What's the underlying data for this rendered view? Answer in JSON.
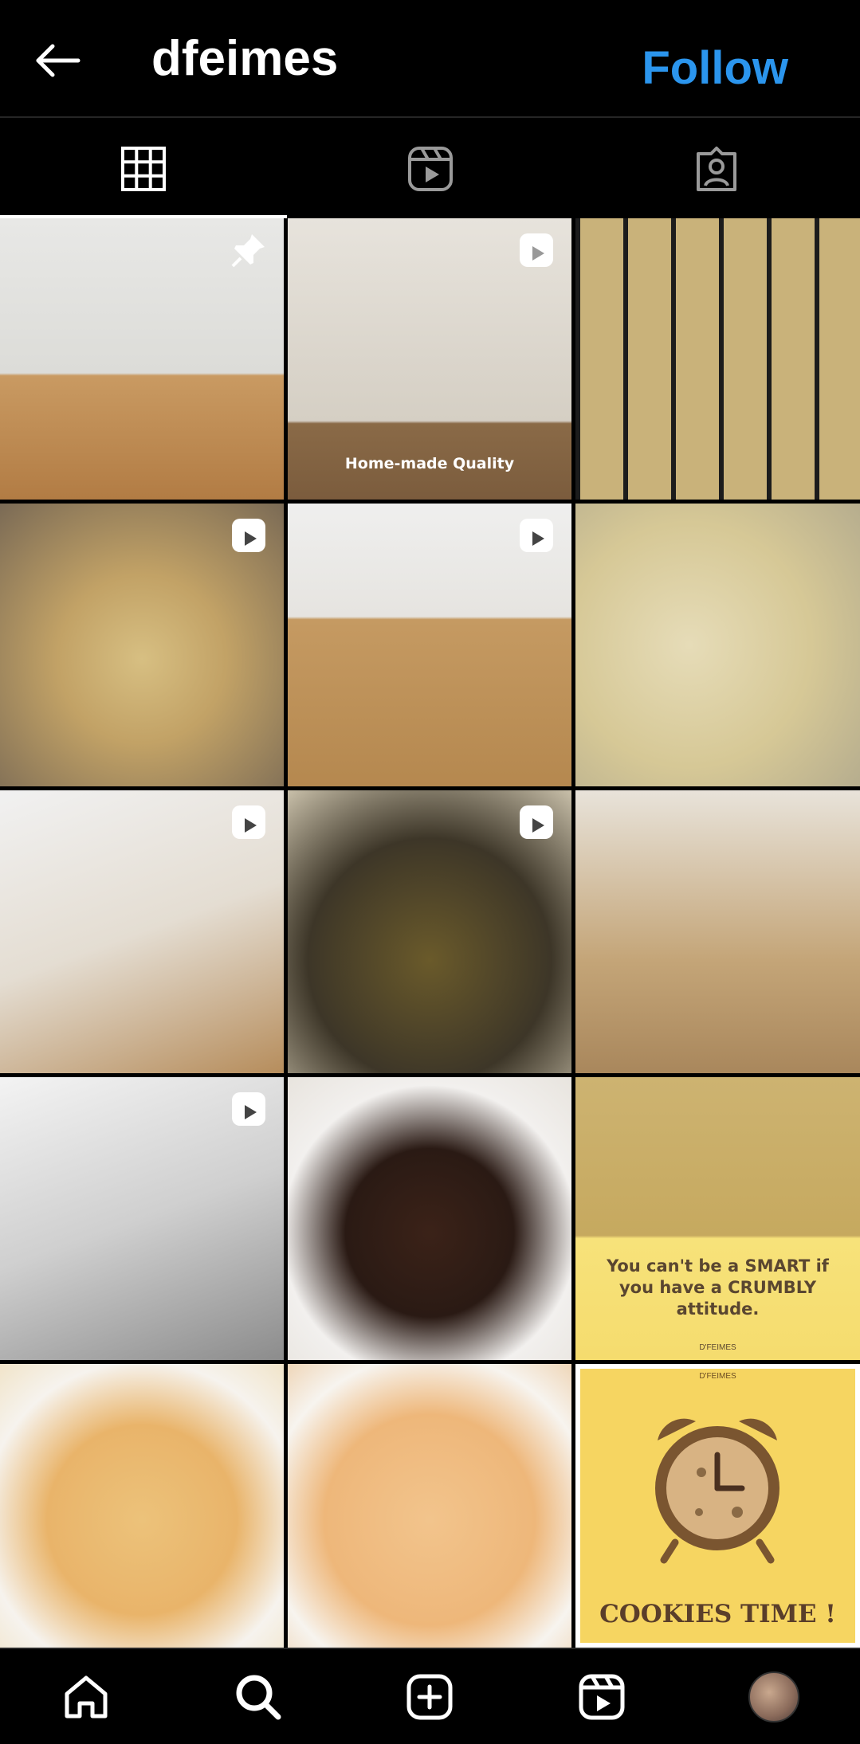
{
  "header": {
    "username": "dfeimes",
    "follow_label": "Follow",
    "back_icon": "arrow-left-icon"
  },
  "tabs": [
    {
      "name": "posts",
      "icon": "grid-icon",
      "active": true
    },
    {
      "name": "reels",
      "icon": "reels-icon",
      "active": false
    },
    {
      "name": "tagged",
      "icon": "tagged-user-icon",
      "active": false
    }
  ],
  "grid": {
    "cells": [
      {
        "kind": "pinned",
        "caption": ""
      },
      {
        "kind": "reel",
        "caption": "Home-made Quality"
      },
      {
        "kind": "photo",
        "caption": ""
      },
      {
        "kind": "reel",
        "caption": ""
      },
      {
        "kind": "reel",
        "caption": ""
      },
      {
        "kind": "photo",
        "caption": ""
      },
      {
        "kind": "reel",
        "caption": ""
      },
      {
        "kind": "reel",
        "caption": ""
      },
      {
        "kind": "photo",
        "caption": ""
      },
      {
        "kind": "reel",
        "caption": ""
      },
      {
        "kind": "photo",
        "caption": ""
      },
      {
        "kind": "photo",
        "caption": "You can't be a SMART if you have a CRUMBLY attitude.",
        "brand": "D'FEIMES"
      },
      {
        "kind": "photo",
        "caption": ""
      },
      {
        "kind": "photo",
        "caption": ""
      },
      {
        "kind": "photo",
        "caption": "COOKIES TIME !",
        "brand": "D'FEIMES"
      }
    ]
  },
  "nav": [
    {
      "name": "home",
      "icon": "home-icon"
    },
    {
      "name": "search",
      "icon": "search-icon"
    },
    {
      "name": "create",
      "icon": "plus-square-icon"
    },
    {
      "name": "reels",
      "icon": "reels-icon"
    },
    {
      "name": "profile",
      "icon": "avatar"
    }
  ],
  "colors": {
    "background": "#000000",
    "follow_blue": "#2b95ed",
    "divider": "#262626"
  }
}
